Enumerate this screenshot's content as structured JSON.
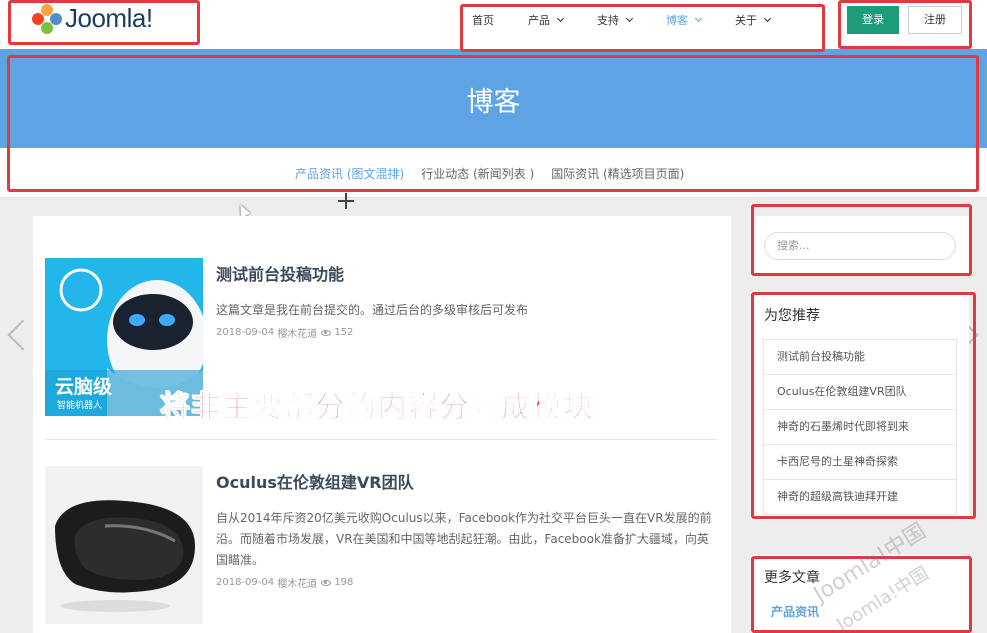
{
  "header": {
    "logo_text": "Joomla!",
    "nav": [
      {
        "label": "首页",
        "has_dropdown": false,
        "active": false
      },
      {
        "label": "产品",
        "has_dropdown": true,
        "active": false
      },
      {
        "label": "支持",
        "has_dropdown": true,
        "active": false
      },
      {
        "label": "博客",
        "has_dropdown": true,
        "active": true
      },
      {
        "label": "关于",
        "has_dropdown": true,
        "active": false
      }
    ],
    "login_label": "登录",
    "register_label": "注册"
  },
  "banner": {
    "title": "博客",
    "subnav": [
      {
        "label": "产品资讯 (图文混排)",
        "active": true
      },
      {
        "label": "行业动态 (新闻列表 )",
        "active": false
      },
      {
        "label": "国际资讯 (精选项目页面)",
        "active": false
      }
    ]
  },
  "articles": [
    {
      "title": "测试前台投稿功能",
      "excerpt": "这篇文章是我在前台提交的。通过后台的多级审核后可发布",
      "date": "2018-09-04",
      "author": "樱木花道",
      "views": "152",
      "image_caption": "云脑级",
      "image_subcaption": "智能机器人"
    },
    {
      "title": "Oculus在伦敦组建VR团队",
      "excerpt": "自从2014年斥资20亿美元收购Oculus以来，Facebook作为社交平台巨头一直在VR发展的前沿。而随着市场发展，VR在美国和中国等地刮起狂潮。由此，Facebook准备扩大疆域，向英国瞄准。",
      "date": "2018-09-04",
      "author": "樱木花道",
      "views": "198"
    }
  ],
  "sidebar": {
    "search_placeholder": "搜索...",
    "recommend_title": "为您推荐",
    "recommend_items": [
      "测试前台投稿功能",
      "Oculus在伦敦组建VR团队",
      "神奇的石墨烯时代即将到来",
      "卡西尼号的土星神奇探索",
      "神奇的超级高铁迪拜开建"
    ],
    "more_title": "更多文章",
    "more_category": "产品资讯"
  },
  "annotation": {
    "text": "将非主要部分的内容分隔成模块",
    "watermark": "Joomla!中国",
    "color": "#e0393f"
  },
  "colors": {
    "accent": "#5ea3e4",
    "login_button": "#1e9b7a"
  }
}
